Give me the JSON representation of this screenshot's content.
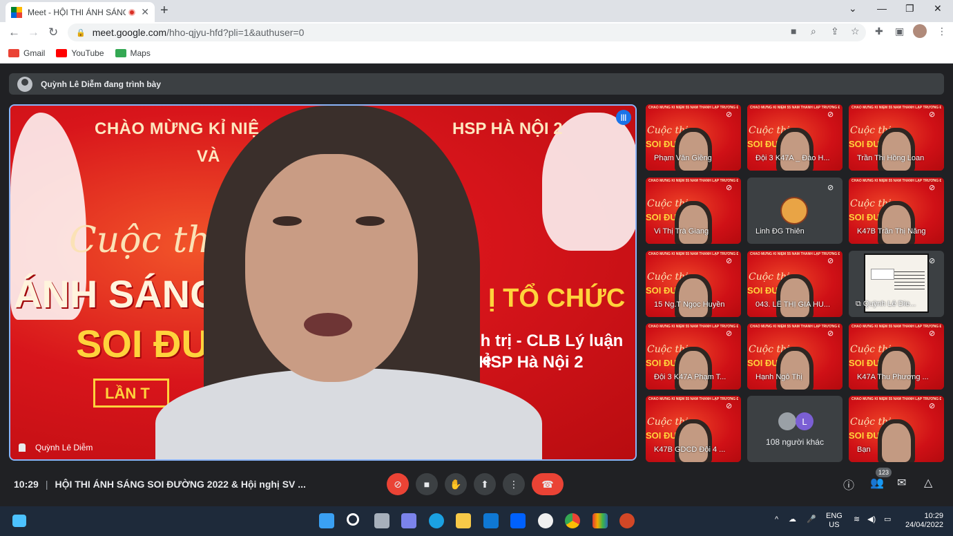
{
  "browser": {
    "tab_title": "Meet - HỘI THI ÁNH SÁNG S",
    "tab_close": "✕",
    "new_tab": "+",
    "url_host": "meet.google.com",
    "url_path": "/hho-qjyu-hfd?pli=1&authuser=0",
    "bookmarks": [
      {
        "label": "Gmail",
        "icon": "gmail-icon",
        "color": "#ea4335"
      },
      {
        "label": "YouTube",
        "icon": "youtube-icon",
        "color": "#ff0000"
      },
      {
        "label": "Maps",
        "icon": "maps-icon",
        "color": "#34a853"
      }
    ]
  },
  "meet": {
    "presenting_banner": "Quỳnh Lê Diễm đang trình bày",
    "main_speaker": {
      "name": "Quỳnh Lê Diễm",
      "slide_text": {
        "top_left": "CHÀO MỪNG KỈ NIỆ",
        "top_right": "HSP HÀ NỘI 2",
        "va": "VÀ",
        "cuoc_thi": "Cuộc th",
        "anh_sang": "ÁNH SÁNG",
        "soi_duong": "SOI ĐƯỜ",
        "to_chuc": "Ị TỔ CHỨC",
        "chinh_tri": "nh trị - CLB Lý luận trẻ",
        "hanoi2": "HSP Hà Nội 2",
        "lan": "LẦN T"
      }
    },
    "participants": [
      {
        "name": "Phạm Văn Giềng",
        "type": "slide"
      },
      {
        "name": "Đội 3 K47A _ Đào H...",
        "type": "slide"
      },
      {
        "name": "Trần Thị Hồng Loan",
        "type": "slide"
      },
      {
        "name": "Vi Thị Trà Giang",
        "type": "slide"
      },
      {
        "name": "Linh ĐG Thiên",
        "type": "avatar"
      },
      {
        "name": "K47B Trần Thị Năng",
        "type": "slide"
      },
      {
        "name": "15 Ng.T Ngọc Huyền",
        "type": "slide"
      },
      {
        "name": "043. LÊ THỊ GIA HU...",
        "type": "slide"
      },
      {
        "name": "Quỳnh Lê Die...",
        "type": "present"
      },
      {
        "name": "Đội 3 K47A Phạm T...",
        "type": "slide"
      },
      {
        "name": "Hạnh Ngô Thị",
        "type": "slide"
      },
      {
        "name": "K47A Thu Phương ...",
        "type": "slide"
      },
      {
        "name": "K47B GDCD Đội 4 ...",
        "type": "slide"
      },
      {
        "name": "108 người khác",
        "type": "others",
        "initial": "L"
      },
      {
        "name": "Bạn",
        "type": "slide"
      }
    ],
    "tile_headline": "CHÀO MỪNG KỈ NIỆM 55 NĂM THÀNH LẬP TRƯỜNG ĐHSP HÀ NỘI 2",
    "tile_cuoc": "Cuộc thi",
    "tile_soi": "SOI ĐƯỜNG",
    "bottom": {
      "time": "10:29",
      "meeting_title": "HỘI THI ÁNH SÁNG SOI ĐƯỜNG 2022 & Hội nghị SV ...",
      "participant_count": "123"
    }
  },
  "taskbar": {
    "lang_top": "ENG",
    "lang_bottom": "US",
    "clock_time": "10:29",
    "clock_date": "24/04/2022"
  }
}
